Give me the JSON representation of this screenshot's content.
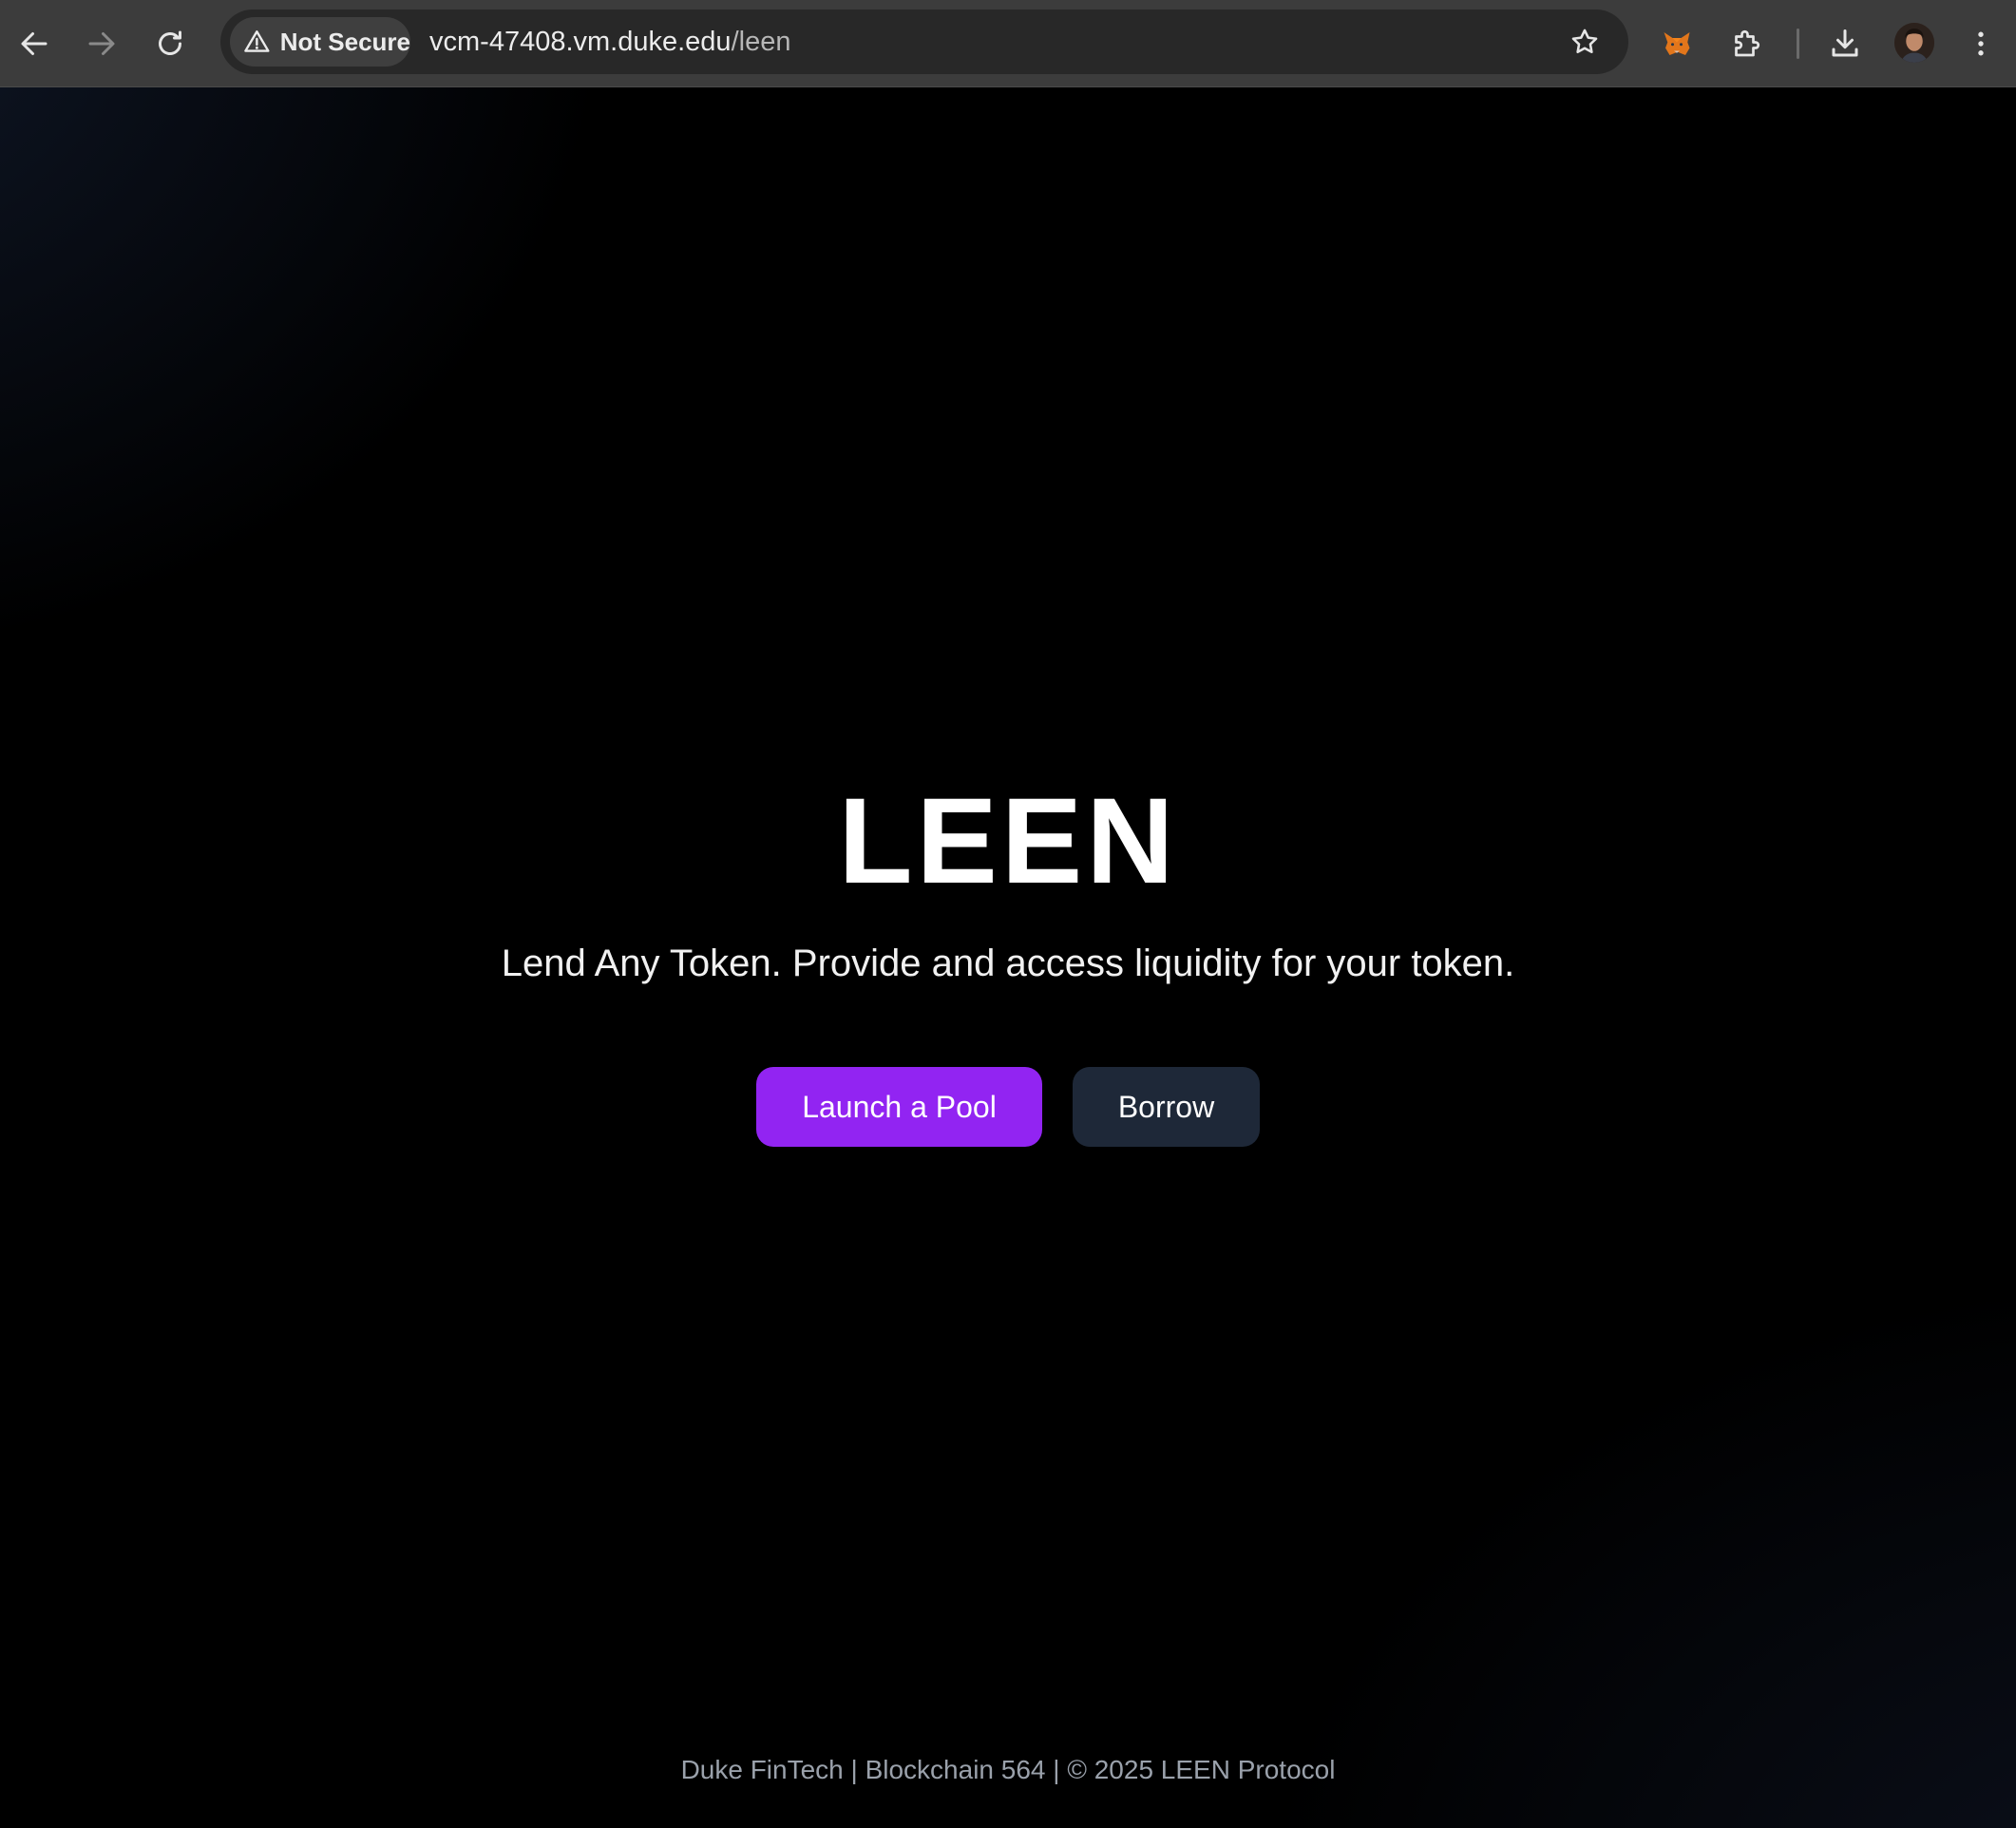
{
  "browser": {
    "security_label": "Not Secure",
    "url_host": "vcm-47408.vm.duke.edu",
    "url_path": "/leen"
  },
  "hero": {
    "title": "LEEN",
    "tagline": "Lend Any Token. Provide and access liquidity for your token."
  },
  "actions": {
    "primary_label": "Launch a Pool",
    "secondary_label": "Borrow"
  },
  "footer": {
    "text": "Duke FinTech | Blockchain 564 | © 2025 LEEN Protocol"
  },
  "colors": {
    "primary_button": "#9224f2",
    "secondary_button": "#1e2838",
    "background": "#000000"
  }
}
